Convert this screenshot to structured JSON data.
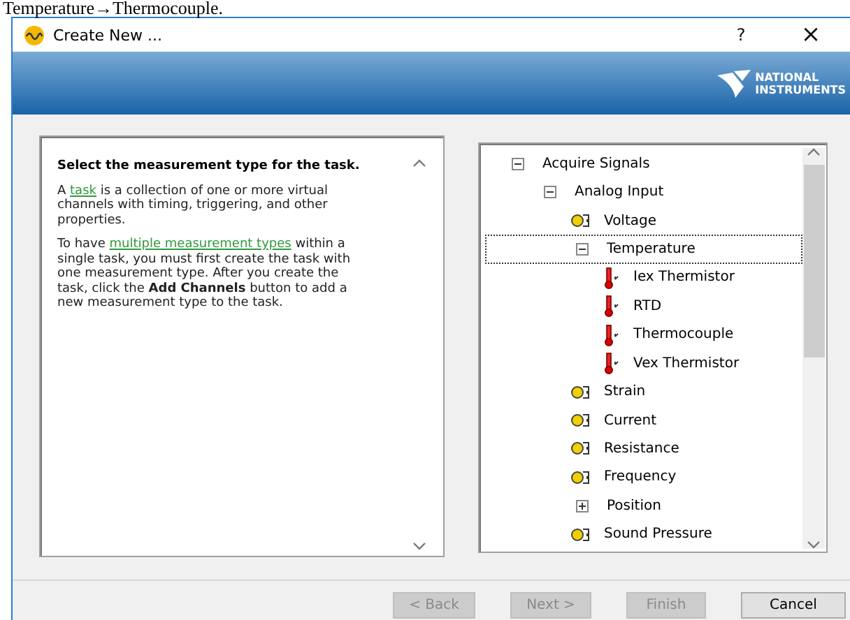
{
  "caption": "Temperature→Thermocouple.",
  "window": {
    "title": "Create New ...",
    "help": "?",
    "close": "×"
  },
  "banner": {
    "logo_line_1": "NATIONAL",
    "logo_line_2": "INSTRUMENTS"
  },
  "help_panel": {
    "heading": "Select the measurement type for the task.",
    "paragraphs": [
      [
        {
          "kind": "text",
          "text": "A "
        },
        {
          "kind": "link",
          "text": "task"
        },
        {
          "kind": "text",
          "text": " is a collection of one or more virtual channels with timing, triggering, and other properties."
        }
      ],
      [
        {
          "kind": "text",
          "text": "To have "
        },
        {
          "kind": "link",
          "text": "multiple measurement types"
        },
        {
          "kind": "text",
          "text": " within a single task, you must first create the task with one measurement type. After you create the task, click the **Add Channels** button to add a new measurement type to the task."
        }
      ]
    ]
  },
  "tree": [
    {
      "label": "Acquire Signals",
      "kind": "group",
      "expanded": true,
      "selected": false,
      "children": [
        {
          "label": "Analog Input",
          "kind": "group",
          "expanded": true,
          "selected": false,
          "children": [
            {
              "label": "Voltage",
              "kind": "leaf",
              "selected": false
            },
            {
              "label": "Temperature",
              "kind": "group",
              "expanded": true,
              "selected": true,
              "children": [
                {
                  "label": "Iex Thermistor",
                  "kind": "leaf",
                  "selected": false
                },
                {
                  "label": "RTD",
                  "kind": "leaf",
                  "selected": false
                },
                {
                  "label": "Thermocouple",
                  "kind": "leaf",
                  "selected": false
                },
                {
                  "label": "Vex Thermistor",
                  "kind": "leaf",
                  "selected": false
                }
              ]
            },
            {
              "label": "Strain",
              "kind": "leaf",
              "selected": false
            },
            {
              "label": "Current",
              "kind": "leaf",
              "selected": false
            },
            {
              "label": "Resistance",
              "kind": "leaf",
              "selected": false
            },
            {
              "label": "Frequency",
              "kind": "leaf",
              "selected": false
            },
            {
              "label": "Position",
              "kind": "group",
              "expanded": false,
              "selected": false
            },
            {
              "label": "Sound Pressure",
              "kind": "leaf",
              "selected": false
            }
          ]
        }
      ]
    }
  ],
  "buttons": [
    {
      "label": "< Back",
      "disabled": true
    },
    {
      "label": "Next >",
      "disabled": true
    },
    {
      "label": "Finish",
      "disabled": true
    },
    {
      "label": "Cancel",
      "disabled": false
    }
  ]
}
